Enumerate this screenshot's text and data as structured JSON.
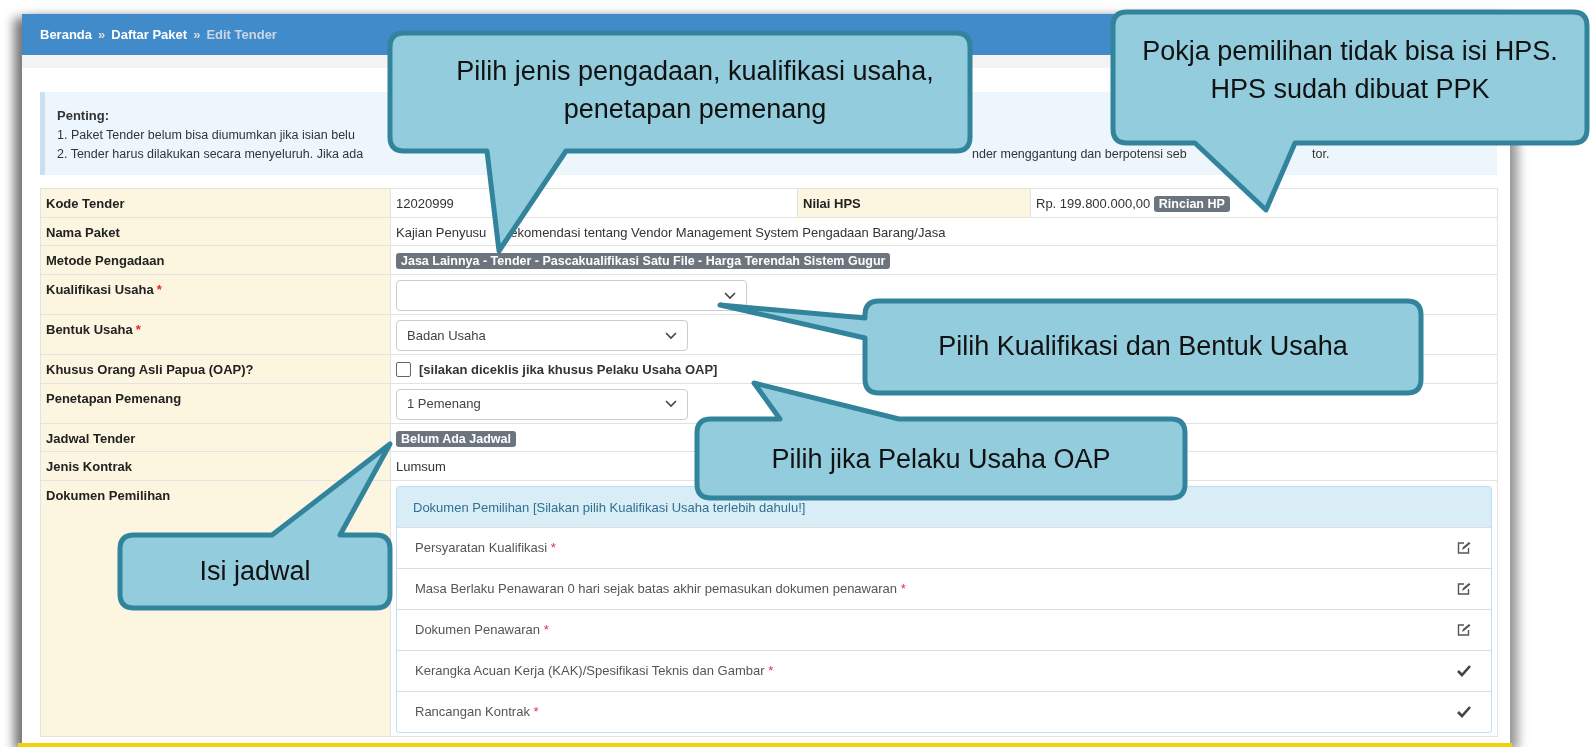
{
  "breadcrumb": {
    "separator": "»",
    "items": [
      {
        "label": "Beranda",
        "kind": "link"
      },
      {
        "label": "Daftar Paket",
        "kind": "link"
      },
      {
        "label": "Edit Tender",
        "kind": "current"
      }
    ]
  },
  "notice": {
    "title": "Penting:",
    "lines": [
      [
        "1. Paket Tender belum bisa diumumkan jika isian belu"
      ],
      [
        "2. Tender harus dilakukan secara menyeluruh. Jika ada",
        "nder menggantung dan berpotensi seb",
        "tor."
      ]
    ]
  },
  "form": {
    "rows": [
      {
        "kind": "text",
        "label": "Kode Tender",
        "value": "12020999",
        "extra_label": "Nilai HPS",
        "extra_value": "Rp. 199.800.000,00",
        "extra_badge": "Rincian HP"
      },
      {
        "kind": "fragments",
        "label": "Nama Paket",
        "fragments": [
          "Kajian Penyusu",
          "ekomendasi tentang Vendor Management System Pengadaan Barang/Jasa"
        ]
      },
      {
        "kind": "badge",
        "label": "Metode Pengadaan",
        "value": "Jasa Lainnya - Tender - Pascakualifikasi Satu File - Harga Terendah Sistem Gugur"
      },
      {
        "kind": "select",
        "label": "Kualifikasi Usaha",
        "required_mark": "*",
        "value": "",
        "wide": true
      },
      {
        "kind": "select",
        "label": "Bentuk Usaha",
        "required_mark": "*",
        "value": "Badan Usaha",
        "wide": false
      },
      {
        "kind": "checkbox",
        "label": "Khusus Orang Asli Papua (OAP)?",
        "checked": false,
        "value": "[silakan diceklis jika khusus Pelaku Usaha OAP]"
      },
      {
        "kind": "select",
        "label": "Penetapan Pemenang",
        "value": "1 Pemenang",
        "wide": false
      },
      {
        "kind": "badge",
        "label": "Jadwal Tender",
        "value": "Belum Ada Jadwal"
      },
      {
        "kind": "text",
        "label": "Jenis Kontrak",
        "value": "Lumsum"
      },
      {
        "kind": "documents",
        "label": "Dokumen Pemilihan",
        "heading": "Dokumen Pemilihan [Silakan pilih Kualifikasi Usaha terlebih dahulu!]",
        "items": [
          {
            "label": "Persyaratan Kualifikasi",
            "required_mark": "*",
            "kind": "edit"
          },
          {
            "label": "Masa Berlaku Penawaran 0 hari sejak batas akhir pemasukan dokumen penawaran",
            "required_mark": "*",
            "kind": "edit"
          },
          {
            "label": "Dokumen Penawaran",
            "required_mark": "*",
            "kind": "edit"
          },
          {
            "label": "Kerangka Acuan Kerja (KAK)/Spesifikasi Teknis dan Gambar",
            "required_mark": "*",
            "kind": "done"
          },
          {
            "label": "Rancangan Kontrak",
            "required_mark": "*",
            "kind": "done"
          }
        ]
      }
    ]
  },
  "callouts": [
    {
      "text": "Pilih jenis pengadaan, kualifikasi usaha, penetapan pemenang"
    },
    {
      "text": "Pokja pemilihan tidak bisa isi HPS. HPS sudah dibuat PPK"
    },
    {
      "text": "Pilih Kualifikasi dan Bentuk Usaha"
    },
    {
      "text": "Pilih jika Pelaku Usaha OAP"
    },
    {
      "text": "Isi jadwal"
    }
  ]
}
